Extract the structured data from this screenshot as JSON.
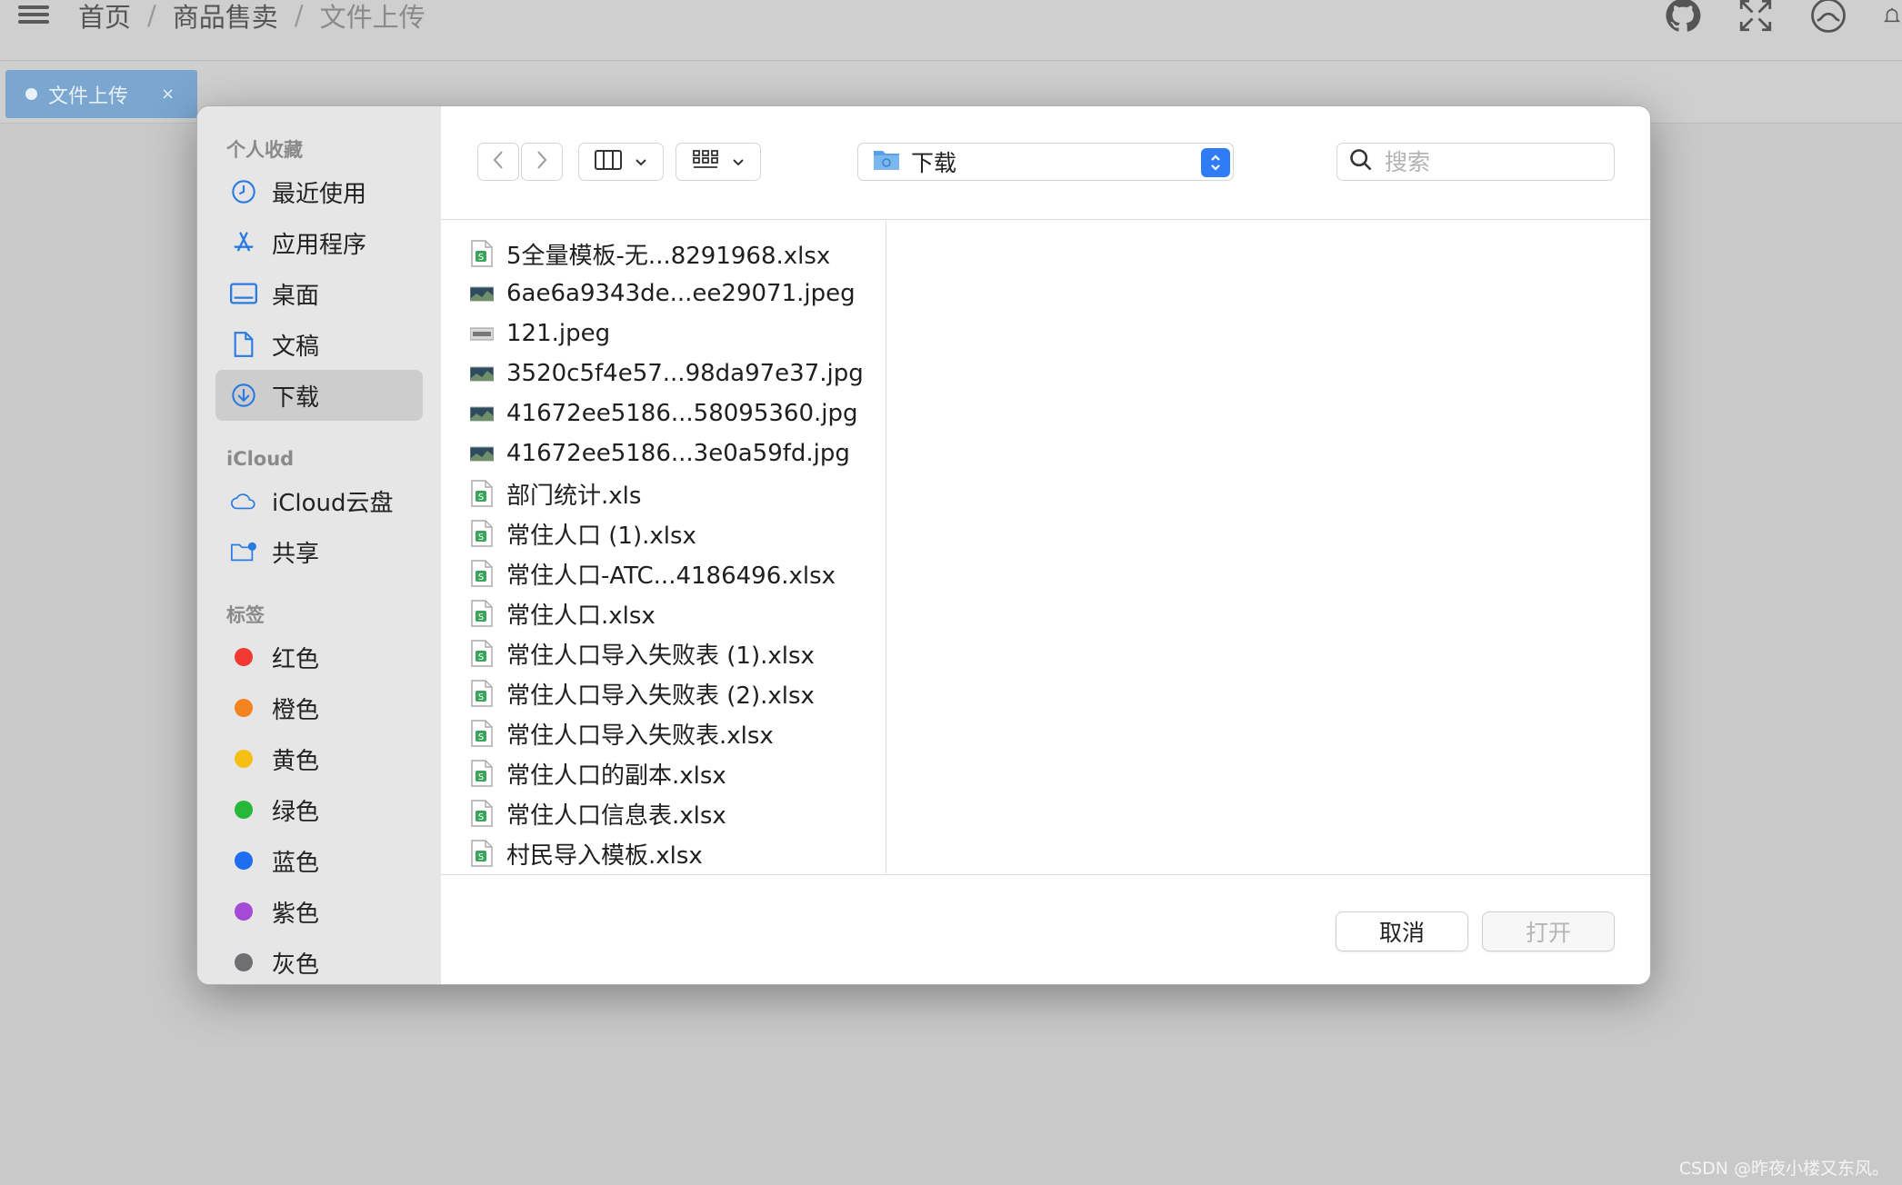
{
  "app": {
    "breadcrumb": [
      "首页",
      "商品售卖",
      "文件上传"
    ],
    "tab": {
      "label": "文件上传",
      "close": "×"
    },
    "icons": [
      "github-icon",
      "fullscreen-icon",
      "theme-icon",
      "bell-icon"
    ],
    "watermark": "CSDN @昨夜小楼又东风。"
  },
  "dialog": {
    "sidebar": {
      "favorites_title": "个人收藏",
      "favorites": [
        {
          "label": "最近使用",
          "icon": "clock-icon"
        },
        {
          "label": "应用程序",
          "icon": "apps-icon"
        },
        {
          "label": "桌面",
          "icon": "desktop-icon"
        },
        {
          "label": "文稿",
          "icon": "document-icon"
        },
        {
          "label": "下载",
          "icon": "download-icon",
          "active": true
        }
      ],
      "icloud_title": "iCloud",
      "icloud": [
        {
          "label": "iCloud云盘",
          "icon": "cloud-icon"
        },
        {
          "label": "共享",
          "icon": "shared-folder-icon"
        }
      ],
      "tags_title": "标签",
      "tags": [
        {
          "label": "红色",
          "color": "#f03a33"
        },
        {
          "label": "橙色",
          "color": "#f3821f"
        },
        {
          "label": "黄色",
          "color": "#f5bf13"
        },
        {
          "label": "绿色",
          "color": "#27b83a"
        },
        {
          "label": "蓝色",
          "color": "#1d6ef0"
        },
        {
          "label": "紫色",
          "color": "#a54ad6"
        },
        {
          "label": "灰色",
          "color": "#6f6f72"
        }
      ]
    },
    "toolbar": {
      "location": "下载",
      "search_placeholder": "搜索"
    },
    "files": [
      {
        "name": "5全量模板-无...8291968.xlsx",
        "type": "sheet"
      },
      {
        "name": "6ae6a9343de...ee29071.jpeg",
        "type": "image"
      },
      {
        "name": "121.jpeg",
        "type": "image-light"
      },
      {
        "name": "3520c5f4e57...98da97e37.jpg",
        "type": "image"
      },
      {
        "name": "41672ee5186...58095360.jpg",
        "type": "image"
      },
      {
        "name": "41672ee5186...3e0a59fd.jpg",
        "type": "image"
      },
      {
        "name": "部门统计.xls",
        "type": "sheet"
      },
      {
        "name": "常住人口 (1).xlsx",
        "type": "sheet"
      },
      {
        "name": "常住人口-ATC...4186496.xlsx",
        "type": "sheet"
      },
      {
        "name": "常住人口.xlsx",
        "type": "sheet"
      },
      {
        "name": "常住人口导入失败表 (1).xlsx",
        "type": "sheet"
      },
      {
        "name": "常住人口导入失败表 (2).xlsx",
        "type": "sheet"
      },
      {
        "name": "常住人口导入失败表.xlsx",
        "type": "sheet"
      },
      {
        "name": "常住人口的副本.xlsx",
        "type": "sheet"
      },
      {
        "name": "常住人口信息表.xlsx",
        "type": "sheet"
      },
      {
        "name": "村民导入模板.xlsx",
        "type": "sheet"
      }
    ],
    "footer": {
      "cancel": "取消",
      "open": "打开"
    }
  }
}
